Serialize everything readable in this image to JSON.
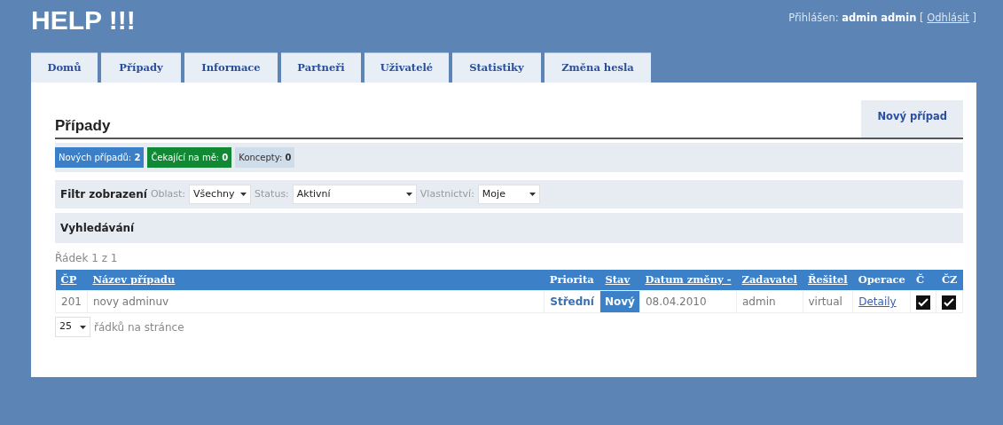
{
  "app_title": "HELP !!!",
  "login": {
    "label": "Přihlášen:",
    "user": "admin admin",
    "open_bracket": "[",
    "logout": "Odhlásit",
    "close_bracket": "]"
  },
  "tabs": [
    {
      "label": "Domů",
      "selected": false
    },
    {
      "label": "Případy",
      "selected": false
    },
    {
      "label": "Informace",
      "selected": false
    },
    {
      "label": "Partneři",
      "selected": false
    },
    {
      "label": "Uživatelé",
      "selected": false
    },
    {
      "label": "Statistiky",
      "selected": false
    },
    {
      "label": "Změna hesla",
      "selected": false
    }
  ],
  "page_title": "Případy",
  "new_button": "Nový případ",
  "counters": [
    {
      "label": "Nových případů:",
      "count": "2",
      "color": "#3a7fc8"
    },
    {
      "label": "Čekající na mě:",
      "count": "0",
      "color": "#118833"
    },
    {
      "label": "Koncepty:",
      "count": "0",
      "color": "#cfdcea"
    }
  ],
  "filter": {
    "title": "Filtr zobrazení",
    "selects": [
      {
        "label": "Oblast:",
        "value": "Všechny"
      },
      {
        "label": "Status:",
        "value": "Aktivní"
      },
      {
        "label": "Vlastnictví:",
        "value": "Moje"
      }
    ]
  },
  "search_title": "Vyhledávání",
  "row_count": "Řádek 1 z 1",
  "table": {
    "columns": [
      {
        "label": "ČP",
        "sortable": true
      },
      {
        "label": "Název případu",
        "sortable": true
      },
      {
        "label": "Priorita",
        "sortable": false
      },
      {
        "label": "Stav",
        "sortable": true
      },
      {
        "label": "Datum změny -",
        "sortable": true
      },
      {
        "label": "Zadavatel",
        "sortable": true
      },
      {
        "label": "Řešitel",
        "sortable": true
      },
      {
        "label": "Operace",
        "sortable": false
      },
      {
        "label": "Č",
        "sortable": false
      },
      {
        "label": "ČZ",
        "sortable": false
      }
    ],
    "rows": [
      {
        "cells": [
          {
            "kind": "text",
            "text": "201"
          },
          {
            "kind": "text",
            "text": "novy adminuv"
          },
          {
            "kind": "priority",
            "text": "Střední"
          },
          {
            "kind": "status",
            "text": "Nový"
          },
          {
            "kind": "text",
            "text": "08.04.2010"
          },
          {
            "kind": "text",
            "text": "admin"
          },
          {
            "kind": "text",
            "text": "virtual"
          },
          {
            "kind": "link",
            "text": "Detaily"
          },
          {
            "kind": "check",
            "checked": true
          },
          {
            "kind": "check",
            "checked": true
          }
        ]
      }
    ]
  },
  "page_size": {
    "value": "25",
    "label": "řádků na stránce"
  }
}
